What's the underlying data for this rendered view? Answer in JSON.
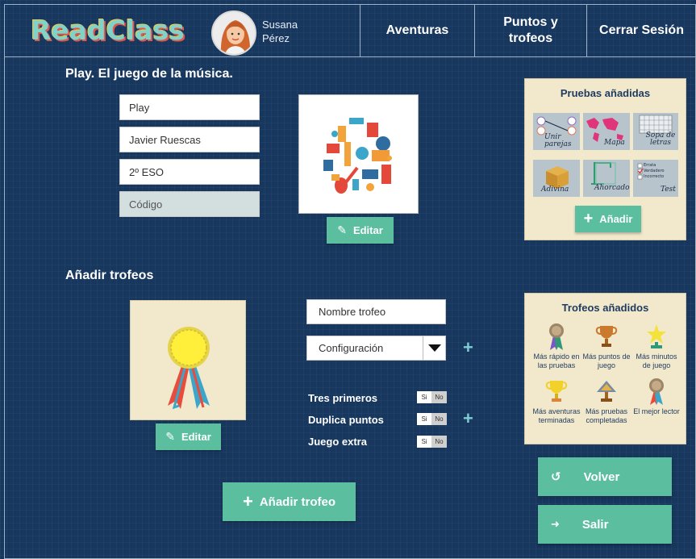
{
  "header": {
    "logo_text": "ReadClass",
    "user_first_name": "Susana",
    "user_last_name": "Pérez",
    "nav": [
      "Aventuras",
      "Puntos y trofeos",
      "Cerrar Sesión"
    ]
  },
  "adventure": {
    "title": "Play. El juego de la música.",
    "fields": [
      {
        "value": "Play",
        "placeholder": ""
      },
      {
        "value": "Javier Ruescas",
        "placeholder": ""
      },
      {
        "value": "2º ESO",
        "placeholder": ""
      },
      {
        "value": "",
        "placeholder": "Código"
      }
    ],
    "edit_label": "Editar"
  },
  "tests_panel": {
    "title": "Pruebas añadidas",
    "tiles": [
      {
        "label": "Unir parejas",
        "icon": "match-pairs-icon"
      },
      {
        "label": "Mapa",
        "icon": "world-map-icon"
      },
      {
        "label": "Sopa de letras",
        "icon": "word-search-icon"
      },
      {
        "label": "Adivina",
        "icon": "box-icon"
      },
      {
        "label": "Ahorcado",
        "icon": "hangman-icon"
      },
      {
        "label": "Test",
        "icon": "checklist-icon"
      }
    ],
    "test_options": [
      "Errata",
      "Verdadero",
      "Incorrecto"
    ],
    "add_label": "Añadir"
  },
  "trophies_section": {
    "title": "Añadir trofeos",
    "edit_label": "Editar",
    "name_placeholder": "Nombre trofeo",
    "config_value": "Configuración",
    "options": [
      {
        "label": "Tres primeros",
        "yes": "Si",
        "no": "No"
      },
      {
        "label": "Duplica puntos",
        "yes": "Si",
        "no": "No"
      },
      {
        "label": "Juego extra",
        "yes": "Si",
        "no": "No"
      }
    ],
    "add_trophy_label": "Añadir trofeo"
  },
  "trophies_panel": {
    "title": "Trofeos añadidos",
    "items": [
      {
        "label": "Más rápido en las pruebas",
        "icon": "medal-icon"
      },
      {
        "label": "Más puntos de juego",
        "icon": "cup-icon"
      },
      {
        "label": "Más minutos de juego",
        "icon": "star-icon"
      },
      {
        "label": "Más aventuras terminadas",
        "icon": "gold-cup-icon"
      },
      {
        "label": "Más pruebas completadas",
        "icon": "pyramid-trophy-icon"
      },
      {
        "label": "El mejor lector",
        "icon": "rosette-icon"
      }
    ]
  },
  "actions": {
    "back_label": "Volver",
    "exit_label": "Salir"
  },
  "colors": {
    "background": "#17375e",
    "accent_green": "#5bbf9f",
    "panel": "#f2e9cd",
    "plus_blue": "#7ecdd5"
  }
}
